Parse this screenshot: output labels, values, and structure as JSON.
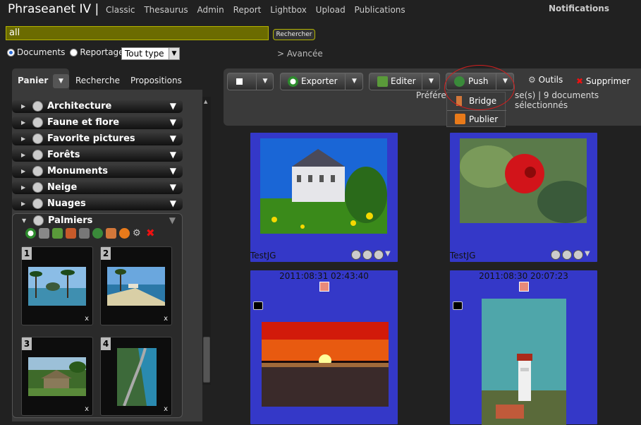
{
  "app": {
    "title": "Phraseanet IV |",
    "notifications": "Notifications"
  },
  "nav": [
    "Classic",
    "Thesaurus",
    "Admin",
    "Report",
    "Lightbox",
    "Upload",
    "Publications"
  ],
  "search": {
    "value": "all",
    "button": "Rechercher",
    "advanced": "> Avancée"
  },
  "mode": {
    "documents": "Documents",
    "reportage": "Reportage",
    "type": "Tout type"
  },
  "left_tabs": {
    "panier": "Panier",
    "recherche": "Recherche",
    "propositions": "Propositions"
  },
  "baskets": [
    "Architecture",
    "Faune et flore",
    "Favorite pictures",
    "Forêts",
    "Monuments",
    "Neige",
    "Nuages",
    "Palmiers"
  ],
  "palm_items": [
    {
      "n": "1",
      "x": "x"
    },
    {
      "n": "2",
      "x": "x"
    },
    {
      "n": "3",
      "x": "x"
    },
    {
      "n": "4",
      "x": "x"
    }
  ],
  "toolbar": {
    "exporter": "Exporter",
    "editer": "Editer",
    "push": "Push",
    "outils": "Outils",
    "supprimer": "Supprimer"
  },
  "info": {
    "left": "Préféren",
    "right": "se(s) | 9 documents sélectionnés"
  },
  "push_menu": {
    "bridge": "Bridge",
    "publier": "Publier"
  },
  "results": [
    {
      "caption": "TestJG"
    },
    {
      "caption": "TestJG"
    },
    {
      "date": "2011:08:31 02:43:40"
    },
    {
      "date": "2011:08:30 20:07:23"
    }
  ],
  "colors": {
    "accent": "#3438c8",
    "search_bg": "#6b6b00",
    "highlight": "#d21e1e"
  }
}
